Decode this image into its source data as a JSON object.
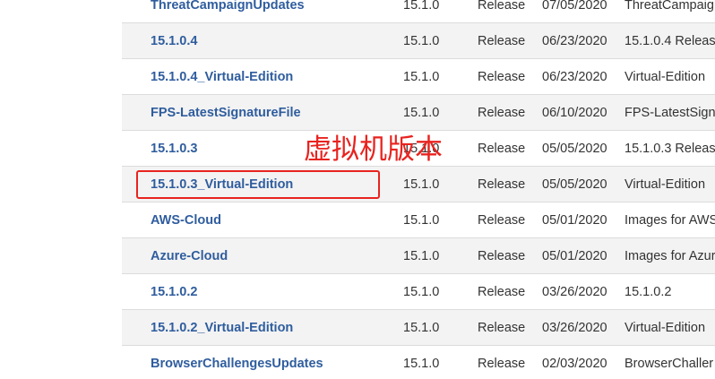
{
  "rows": [
    {
      "name": "ThreatCampaignUpdates",
      "version": "15.1.0",
      "type": "Release",
      "date": "07/05/2020",
      "description": "ThreatCampaig"
    },
    {
      "name": "15.1.0.4",
      "version": "15.1.0",
      "type": "Release",
      "date": "06/23/2020",
      "description": "15.1.0.4 Releas"
    },
    {
      "name": "15.1.0.4_Virtual-Edition",
      "version": "15.1.0",
      "type": "Release",
      "date": "06/23/2020",
      "description": "Virtual-Edition"
    },
    {
      "name": "FPS-LatestSignatureFile",
      "version": "15.1.0",
      "type": "Release",
      "date": "06/10/2020",
      "description": "FPS-LatestSign"
    },
    {
      "name": "15.1.0.3",
      "version": "15.1.0",
      "type": "Release",
      "date": "05/05/2020",
      "description": "15.1.0.3 Releas"
    },
    {
      "name": "15.1.0.3_Virtual-Edition",
      "version": "15.1.0",
      "type": "Release",
      "date": "05/05/2020",
      "description": "Virtual-Edition"
    },
    {
      "name": "AWS-Cloud",
      "version": "15.1.0",
      "type": "Release",
      "date": "05/01/2020",
      "description": "Images for AWS"
    },
    {
      "name": "Azure-Cloud",
      "version": "15.1.0",
      "type": "Release",
      "date": "05/01/2020",
      "description": "Images for Azur"
    },
    {
      "name": "15.1.0.2",
      "version": "15.1.0",
      "type": "Release",
      "date": "03/26/2020",
      "description": "15.1.0.2"
    },
    {
      "name": "15.1.0.2_Virtual-Edition",
      "version": "15.1.0",
      "type": "Release",
      "date": "03/26/2020",
      "description": "Virtual-Edition"
    },
    {
      "name": "BrowserChallengesUpdates",
      "version": "15.1.0",
      "type": "Release",
      "date": "02/03/2020",
      "description": "BrowserChaller"
    }
  ],
  "annotation": {
    "text": "虚拟机版本",
    "highlighted_row": "15.1.0.3_Virtual-Edition",
    "color": "#e8231f"
  },
  "colors": {
    "link": "#2f5d9e",
    "row_alt": "#f3f3f3",
    "border": "#dcdcdc"
  }
}
